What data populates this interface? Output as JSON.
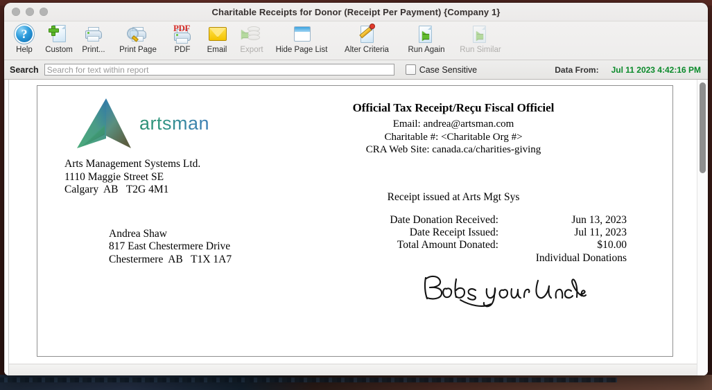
{
  "window": {
    "title": "Charitable Receipts for Donor (Receipt Per Payment) {Company 1}",
    "traffic_lights": [
      "close-button",
      "minimize-button",
      "zoom-button"
    ]
  },
  "toolbar": {
    "items": [
      {
        "label": "Help",
        "icon": "help-icon",
        "enabled": true
      },
      {
        "label": "Custom",
        "icon": "custom-document-icon",
        "enabled": true
      },
      {
        "label": "Print...",
        "icon": "printer-icon",
        "enabled": true
      },
      {
        "label": "Print Page",
        "icon": "print-preview-icon",
        "enabled": true
      },
      {
        "label": "PDF",
        "icon": "pdf-icon",
        "enabled": true
      },
      {
        "label": "Email",
        "icon": "envelope-icon",
        "enabled": true
      },
      {
        "label": "Export",
        "icon": "export-database-icon",
        "enabled": false
      },
      {
        "label": "Hide Page List",
        "icon": "panel-icon",
        "enabled": true
      },
      {
        "label": "Alter Criteria",
        "icon": "pencil-edit-icon",
        "enabled": true
      },
      {
        "label": "Run Again",
        "icon": "run-arrow-icon",
        "enabled": true
      },
      {
        "label": "Run Similar",
        "icon": "run-arrow-icon",
        "enabled": false
      }
    ]
  },
  "search": {
    "label": "Search",
    "placeholder": "Search for text within report",
    "value": "",
    "case_sensitive_label": "Case Sensitive",
    "case_sensitive_checked": false,
    "data_from_label": "Data From:",
    "data_from_value": "Jul 11 2023 4:42:16 PM",
    "data_from_color": "#0a8a2a"
  },
  "receipt": {
    "logo_text": "artsman",
    "logo_colors": {
      "blue": "#3f7fb5",
      "green": "#2e8f74"
    },
    "company_address": "Arts Management Systems Ltd.\n1110 Maggie Street SE\nCalgary  AB   T2G 4M1",
    "title": "Official Tax Receipt/Reçu Fiscal Officiel",
    "org_lines": "Email: andrea@artsman.com\nCharitable #: <Charitable Org #>\nCRA Web Site: canada.ca/charities-giving",
    "donor_address": "Andrea Shaw\n817 East Chestermere Drive\nChestermere  AB   T1X 1A7",
    "issued_line": "Receipt issued at Arts Mgt Sys",
    "details": [
      {
        "key": "Date Donation Received:",
        "value": "Jun 13, 2023"
      },
      {
        "key": "Date Receipt Issued:",
        "value": "Jul 11, 2023"
      },
      {
        "key": "Total Amount Donated:",
        "value": "$10.00"
      },
      {
        "key": "",
        "value": "Individual Donations"
      }
    ],
    "signature_text": "Bobs your Uncle"
  }
}
